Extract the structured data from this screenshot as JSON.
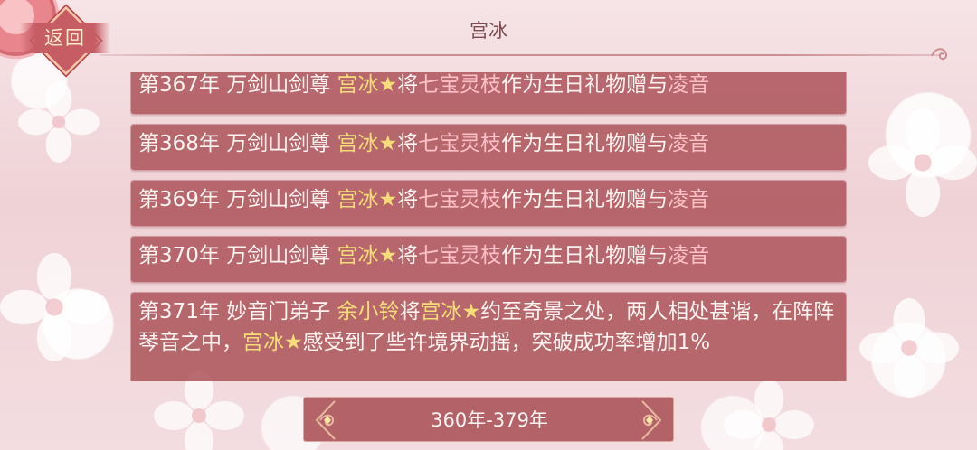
{
  "header": {
    "back_label": "返回",
    "title": "宫冰"
  },
  "events": [
    {
      "segments": [
        {
          "text": "第367年 万剑山剑尊 ",
          "style": "plain"
        },
        {
          "text": "宫冰",
          "style": "gold"
        },
        {
          "text": "★",
          "style": "gold"
        },
        {
          "text": "将",
          "style": "plain"
        },
        {
          "text": "七宝灵枝",
          "style": "pink"
        },
        {
          "text": "作为生日礼物赠与",
          "style": "plain"
        },
        {
          "text": "凌音",
          "style": "pink"
        }
      ]
    },
    {
      "segments": [
        {
          "text": "第368年 万剑山剑尊 ",
          "style": "plain"
        },
        {
          "text": "宫冰",
          "style": "gold"
        },
        {
          "text": "★",
          "style": "gold"
        },
        {
          "text": "将",
          "style": "plain"
        },
        {
          "text": "七宝灵枝",
          "style": "pink"
        },
        {
          "text": "作为生日礼物赠与",
          "style": "plain"
        },
        {
          "text": "凌音",
          "style": "pink"
        }
      ]
    },
    {
      "segments": [
        {
          "text": "第369年 万剑山剑尊 ",
          "style": "plain"
        },
        {
          "text": "宫冰",
          "style": "gold"
        },
        {
          "text": "★",
          "style": "gold"
        },
        {
          "text": "将",
          "style": "plain"
        },
        {
          "text": "七宝灵枝",
          "style": "pink"
        },
        {
          "text": "作为生日礼物赠与",
          "style": "plain"
        },
        {
          "text": "凌音",
          "style": "pink"
        }
      ]
    },
    {
      "segments": [
        {
          "text": "第370年 万剑山剑尊 ",
          "style": "plain"
        },
        {
          "text": "宫冰",
          "style": "gold"
        },
        {
          "text": "★",
          "style": "gold"
        },
        {
          "text": "将",
          "style": "plain"
        },
        {
          "text": "七宝灵枝",
          "style": "pink"
        },
        {
          "text": "作为生日礼物赠与",
          "style": "plain"
        },
        {
          "text": "凌音",
          "style": "pink"
        }
      ]
    },
    {
      "segments": [
        {
          "text": "第371年 妙音门弟子 ",
          "style": "plain"
        },
        {
          "text": "余小铃",
          "style": "gold"
        },
        {
          "text": "将",
          "style": "plain"
        },
        {
          "text": "宫冰",
          "style": "gold"
        },
        {
          "text": "★",
          "style": "gold"
        },
        {
          "text": "约至奇景之处，两人相处甚谐，在阵阵琴音之中，",
          "style": "plain"
        },
        {
          "text": "宫冰",
          "style": "gold"
        },
        {
          "text": "★",
          "style": "gold"
        },
        {
          "text": "感受到了些许境界动摇，突破成功率增加1%",
          "style": "plain"
        }
      ]
    }
  ],
  "range_selector": {
    "label": "360年-379年"
  },
  "colors": {
    "card_bg": "#ac545a",
    "highlight_gold": "#f7dc7a",
    "highlight_pink": "#ffc0c8",
    "text_main": "#fff4f2"
  }
}
